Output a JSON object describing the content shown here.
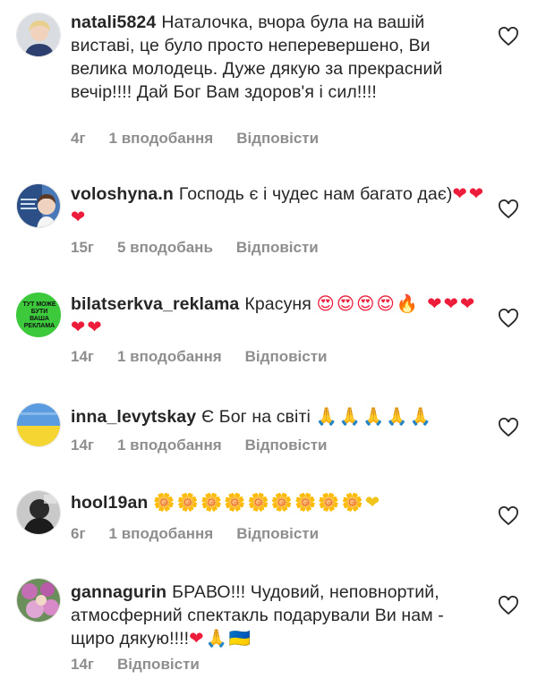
{
  "comments": [
    {
      "username": "natali5824",
      "text": "Наталочка, вчора була на вашій виставі, це було просто неперевершено, Ви велика молодець. Дуже дякую за прекрасний вечір!!!! Дай Бог Вам здоров'я і сил!!!!",
      "emoji": "",
      "time": "4г",
      "likes": "1 вподобання",
      "reply": "Відповісти",
      "avatar_icon": "woman-portrait-avatar"
    },
    {
      "username": "voloshyna.n",
      "text": "Господь є і чудес нам багато дає)",
      "emoji": "❤❤❤",
      "time": "15г",
      "likes": "5 вподобань",
      "reply": "Відповісти",
      "avatar_icon": "woman-quote-avatar"
    },
    {
      "username": "bilatserkva_reklama",
      "text": "Красуня",
      "emoji": "😍😍😍😍🔥 ❤❤❤❤❤",
      "time": "14г",
      "likes": "1 вподобання",
      "reply": "Відповісти",
      "avatar_icon": "ad-banner-avatar",
      "avatar_text": "ТУТ МОЖЕ БУТИ ВАША РЕКЛАМА"
    },
    {
      "username": "inna_levytskay",
      "text": "Є Бог на світі",
      "emoji": "🙏🙏🙏🙏🙏",
      "time": "14г",
      "likes": "1 вподобання",
      "reply": "Відповісти",
      "avatar_icon": "ukraine-flag-avatar"
    },
    {
      "username": "hool19an",
      "text": "",
      "emoji": "🌼🌼🌼🌼🌼🌼🌼🌼🌼❤",
      "time": "6г",
      "likes": "1 вподобання",
      "reply": "Відповісти",
      "avatar_icon": "dark-photo-avatar"
    },
    {
      "username": "gannagurin",
      "text": "БРАВО!!! Чудовий, неповнортий, атмосферний спектакль подарували Ви нам - щиро дякую!!!!",
      "emoji": "❤🙏🇺🇦",
      "time": "14г",
      "likes": "",
      "reply": "Відповісти",
      "avatar_icon": "flowers-photo-avatar"
    }
  ],
  "colors": {
    "text": "#262626",
    "meta": "#8e8e8e",
    "heart_red": "#ed1c3a",
    "ad_green": "#3cc93c"
  }
}
